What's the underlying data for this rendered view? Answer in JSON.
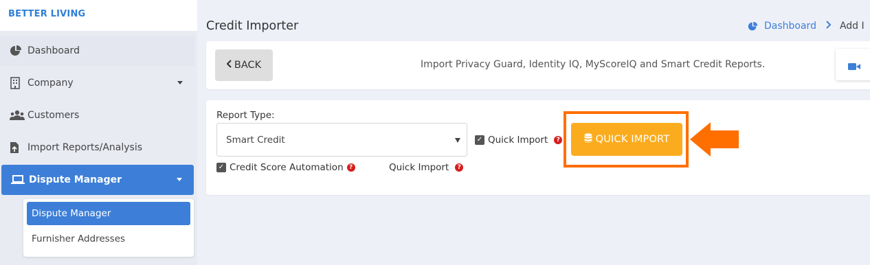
{
  "brand": "BETTER LIVING",
  "sidebar": {
    "items": [
      {
        "label": "Dashboard",
        "icon": "pie-chart-icon"
      },
      {
        "label": "Company",
        "icon": "building-icon"
      },
      {
        "label": "Customers",
        "icon": "users-icon"
      },
      {
        "label": "Import Reports/Analysis",
        "icon": "file-import-icon"
      },
      {
        "label": "Dispute Manager",
        "icon": "laptop-icon"
      }
    ],
    "submenu": [
      "Dispute Manager",
      "Furnisher Addresses"
    ]
  },
  "page": {
    "title": "Credit Importer",
    "breadcrumb": {
      "home": "Dashboard",
      "current": "Add I"
    }
  },
  "toolbar": {
    "back_label": "BACK",
    "description": "Import Privacy Guard, Identity IQ, MyScoreIQ and Smart Credit Reports."
  },
  "form": {
    "report_type_label": "Report Type:",
    "report_type_value": "Smart Credit",
    "quick_import_checkbox_label": "Quick Import",
    "credit_score_automation_label": "Credit Score Automation",
    "quick_import_label": "Quick Import",
    "quick_import_button": "QUICK IMPORT",
    "help_glyph": "?"
  },
  "colors": {
    "accent": "#3d7fd8",
    "button_orange": "#fbac1e",
    "highlight": "#ff6f00",
    "help_red": "#d61e1e"
  }
}
